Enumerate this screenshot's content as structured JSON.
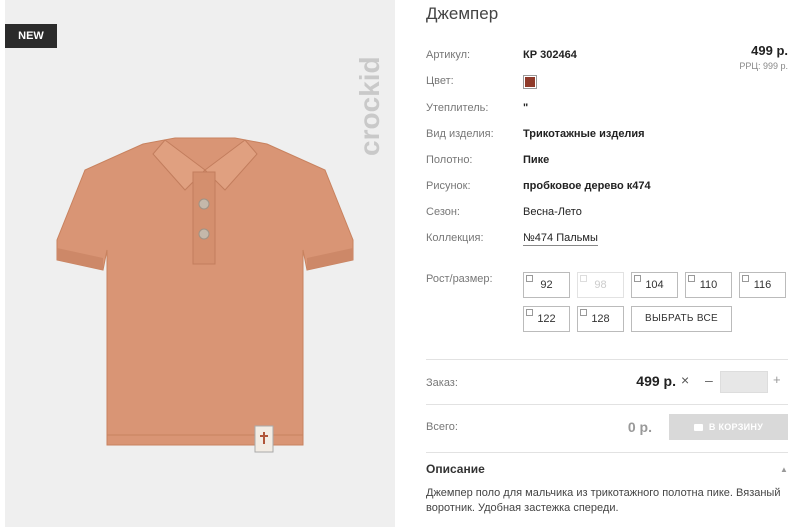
{
  "product": {
    "badge": "NEW",
    "brand": "crockid",
    "title": "Джемпер",
    "price": "499 р.",
    "rrp": "РРЦ: 999 р."
  },
  "attributes": {
    "article": {
      "label": "Артикул:",
      "value": "КР 302464"
    },
    "color": {
      "label": "Цвет:",
      "swatch": "#8f3a2a"
    },
    "insulation": {
      "label": "Утеплитель:",
      "value": "\""
    },
    "type": {
      "label": "Вид изделия:",
      "value": "Трикотажные изделия"
    },
    "fabric": {
      "label": "Полотно:",
      "value": "Пике"
    },
    "pattern": {
      "label": "Рисунок:",
      "value": "пробковое дерево к474"
    },
    "season": {
      "label": "Сезон:",
      "value": "Весна-Лето"
    },
    "collection": {
      "label": "Коллекция:",
      "value": "№474 Пальмы"
    }
  },
  "sizes": {
    "label": "Рост/размер:",
    "items": [
      {
        "value": "92",
        "available": true
      },
      {
        "value": "98",
        "available": false
      },
      {
        "value": "104",
        "available": true
      },
      {
        "value": "110",
        "available": true
      },
      {
        "value": "116",
        "available": true
      },
      {
        "value": "122",
        "available": true
      },
      {
        "value": "128",
        "available": true
      }
    ],
    "select_all": "ВЫБРАТЬ ВСЕ"
  },
  "order": {
    "label": "Заказ:",
    "price": "499 р.",
    "times": "×",
    "minus": "–",
    "plus": "+",
    "quantity": ""
  },
  "total": {
    "label": "Всего:",
    "price": "0 р.",
    "cart_button": "В КОРЗИНУ"
  },
  "description": {
    "title": "Описание",
    "text": "Джемпер поло для мальчика из трикотажного полотна пике. Вязаный воротник. Удобная застежка спереди."
  },
  "colors": {
    "shirt": "#d99575",
    "badge_bg": "#2b2b2b"
  }
}
